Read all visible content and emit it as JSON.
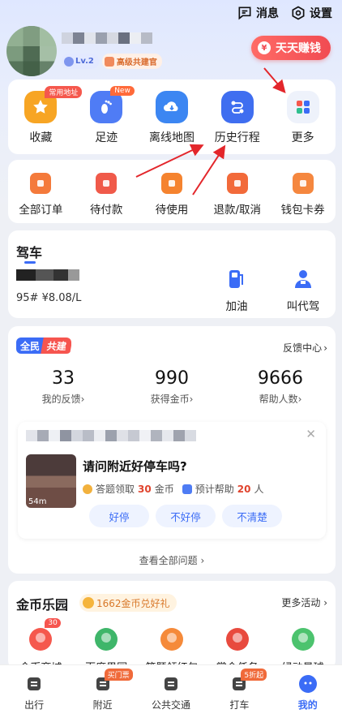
{
  "header": {
    "messages_label": "消息",
    "settings_label": "设置"
  },
  "profile": {
    "level": "Lv.2",
    "role": "高级共建官",
    "earn_label": "天天赚钱"
  },
  "quick_actions": [
    {
      "label": "收藏",
      "tag": "常用地址",
      "icon": "star-icon",
      "color": "#f7a524"
    },
    {
      "label": "足迹",
      "tag": "New",
      "icon": "footprint-icon",
      "color": "#4f7cf5"
    },
    {
      "label": "离线地图",
      "tag": "",
      "icon": "cloud-download-icon",
      "color": "#3c86f2"
    },
    {
      "label": "历史行程",
      "tag": "",
      "icon": "route-icon",
      "color": "#3f6ef0"
    },
    {
      "label": "更多",
      "tag": "",
      "icon": "grid-icon",
      "color": "#eef2fb"
    }
  ],
  "orders": [
    {
      "label": "全部订单",
      "icon": "order-icon",
      "color": "#f47a3b"
    },
    {
      "label": "待付款",
      "icon": "card-icon",
      "color": "#f05a4a"
    },
    {
      "label": "待使用",
      "icon": "clock-icon",
      "color": "#f5832f"
    },
    {
      "label": "退款/取消",
      "icon": "refund-icon",
      "color": "#f26a3a"
    },
    {
      "label": "钱包卡券",
      "icon": "wallet-icon",
      "color": "#f5873f"
    }
  ],
  "drive": {
    "title": "驾车",
    "fuel": "95# ¥8.08/L",
    "actions": [
      "加油",
      "叫代驾"
    ]
  },
  "feedback": {
    "pill_a": "全民",
    "pill_b": "共建",
    "center_link": "反馈中心",
    "stats": [
      {
        "value": "33",
        "label": "我的反馈"
      },
      {
        "value": "990",
        "label": "获得金币"
      },
      {
        "value": "9666",
        "label": "帮助人数"
      }
    ],
    "question": {
      "duration": "54m",
      "title": "请问附近好停车吗?",
      "reward_prefix": "答题领取",
      "reward_value": "30",
      "reward_suffix": "金币",
      "help_prefix": "预计帮助",
      "help_value": "20",
      "help_suffix": "人",
      "answers": [
        "好停",
        "不好停",
        "不清楚"
      ]
    },
    "see_all": "查看全部问题"
  },
  "coins": {
    "title": "金币乐园",
    "badge": "1662金币兑好礼",
    "more": "更多活动",
    "items": [
      {
        "label": "金币商城",
        "tag": "30",
        "icon": "coin-bag-icon"
      },
      {
        "label": "百度果园",
        "tag": "",
        "icon": "tree-icon"
      },
      {
        "label": "答题领红包",
        "tag": "",
        "icon": "red-packet-icon"
      },
      {
        "label": "赏金任务",
        "tag": "",
        "icon": "treasure-chest-icon"
      },
      {
        "label": "绿动星球",
        "tag": "",
        "icon": "planet-icon"
      }
    ]
  },
  "tabbar": [
    {
      "label": "出行",
      "tag": "",
      "icon": "travel-icon"
    },
    {
      "label": "附近",
      "tag": "买门票",
      "icon": "nearby-icon"
    },
    {
      "label": "公共交通",
      "tag": "",
      "icon": "bus-icon"
    },
    {
      "label": "打车",
      "tag": "5折起",
      "icon": "taxi-icon"
    },
    {
      "label": "我的",
      "tag": "",
      "icon": "mine-icon"
    }
  ],
  "colors": {
    "accent": "#3b6cf6",
    "earn": "#f14b52"
  }
}
